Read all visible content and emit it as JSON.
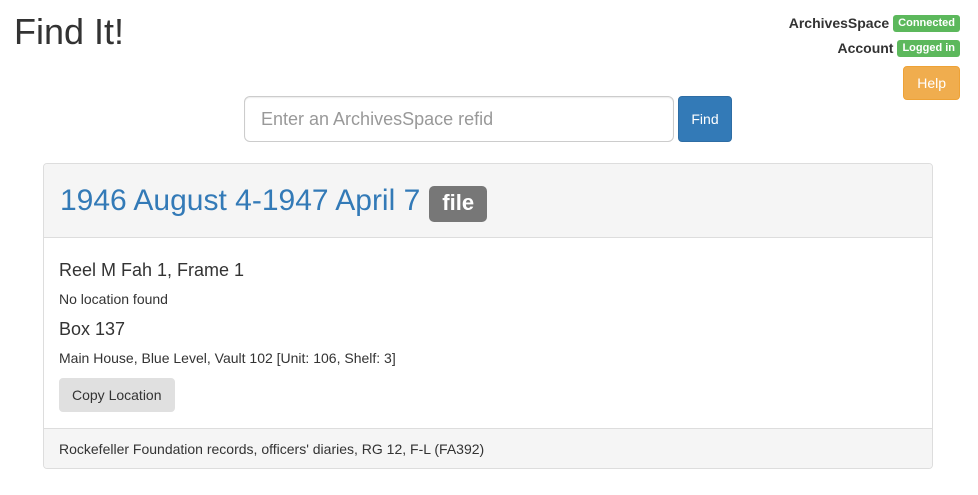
{
  "header": {
    "title": "Find It!"
  },
  "status": {
    "archivesspace_label": "ArchivesSpace",
    "archivesspace_badge": "Connected",
    "account_label": "Account",
    "account_badge": "Logged in",
    "help_label": "Help",
    "badge_color": "#5cb85c",
    "help_color": "#f0ad4e"
  },
  "search": {
    "placeholder": "Enter an ArchivesSpace refid",
    "value": "",
    "find_label": "Find",
    "button_color": "#337ab7"
  },
  "result": {
    "title": "1946 August 4-1947 April 7",
    "type_label": "file",
    "instances": [
      {
        "title": "Reel M Fah 1, Frame 1",
        "location": "No location found"
      },
      {
        "title": "Box 137",
        "location": "Main House, Blue Level, Vault 102 [Unit: 106, Shelf: 3]"
      }
    ],
    "copy_label": "Copy Location",
    "footer": "Rockefeller Foundation records, officers' diaries, RG 12, F-L (FA392)"
  }
}
